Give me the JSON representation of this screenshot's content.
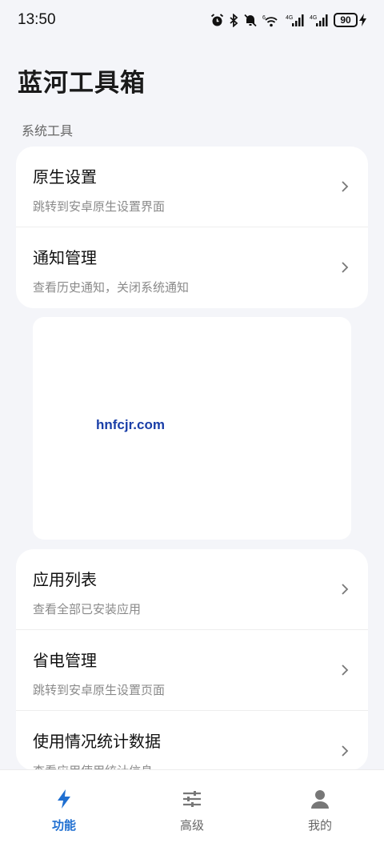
{
  "status": {
    "time": "13:50",
    "battery": "90",
    "icons": [
      "alarm-icon",
      "bluetooth-icon",
      "mute-icon",
      "wifi-icon",
      "signal-4g-icon",
      "signal-4g-icon",
      "charging-icon"
    ]
  },
  "page": {
    "title": "蓝河工具箱"
  },
  "section": {
    "label": "系统工具"
  },
  "card1": {
    "items": [
      {
        "title": "原生设置",
        "subtitle": "跳转到安卓原生设置界面"
      },
      {
        "title": "通知管理",
        "subtitle": "查看历史通知，关闭系统通知"
      }
    ]
  },
  "ad": {
    "watermark": "hnfcjr.com"
  },
  "card2": {
    "items": [
      {
        "title": "应用列表",
        "subtitle": "查看全部已安装应用"
      },
      {
        "title": "省电管理",
        "subtitle": "跳转到安卓原生设置页面"
      },
      {
        "title": "使用情况统计数据",
        "subtitle": "查看应用使用统计信息"
      }
    ]
  },
  "nav": {
    "items": [
      {
        "label": "功能",
        "icon": "lightning-icon",
        "active": true
      },
      {
        "label": "高级",
        "icon": "sliders-icon",
        "active": false
      },
      {
        "label": "我的",
        "icon": "person-icon",
        "active": false
      }
    ]
  },
  "colors": {
    "accent": "#1f6fd1",
    "background": "#f4f5f9"
  }
}
